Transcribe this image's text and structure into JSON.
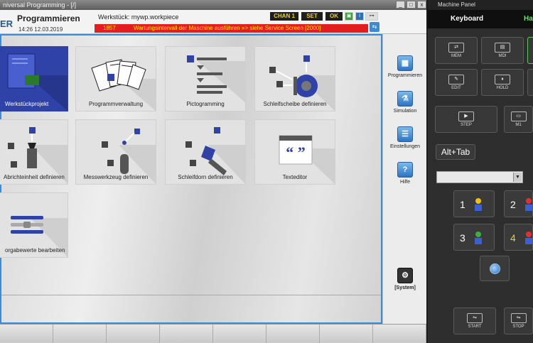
{
  "window": {
    "title": "niversal Programming - [/]",
    "controls": [
      "_",
      "□",
      "x"
    ]
  },
  "header": {
    "logo_text": "ER",
    "title": "Programmieren",
    "datetime": "14:26  12.03.2019",
    "workpiece": "Werkstück: mywp.workpiece",
    "chan": "CHAN 1",
    "set": "SET",
    "ok": "OK",
    "alarm_number": "1857",
    "alarm_text": "Wartungsintervall der Maschine ausführen => siehe Service Screen [2000]"
  },
  "tiles": [
    {
      "label": "Werkstückprojekt",
      "active": true
    },
    {
      "label": "Programmverwaltung",
      "active": false
    },
    {
      "label": "Pictogramming",
      "active": false
    },
    {
      "label": "Schleifscheibe definieren",
      "active": false
    },
    {
      "label": "Abrichteinheit definieren",
      "active": false
    },
    {
      "label": "Messwerkzeug definieren",
      "active": false
    },
    {
      "label": "Schleifdorn definieren",
      "active": false
    },
    {
      "label": "Texteditor",
      "active": false
    },
    {
      "label": "orgabewerte bearbeiten",
      "active": false
    }
  ],
  "right_bar": {
    "programmieren": "Programmieren",
    "simulation": "Simulation",
    "einstellungen": "Einstellungen",
    "hilfe": "Hilfe",
    "system": "[System]"
  },
  "panel": {
    "title": "Machine Panel",
    "keyboard": "Keyboard",
    "handwheel": "Han",
    "buttons": {
      "mem": "MEM",
      "mdi": "MDI",
      "edit": "EDIT",
      "hold": "HOLD",
      "step": "STEP",
      "m1": "M1",
      "start": "START",
      "stop": "STOP"
    },
    "alt_tab": "Alt+Tab",
    "channels": [
      "1",
      "2",
      "3",
      "4"
    ]
  },
  "colors": {
    "accent": "#2f42a8",
    "alarm_bg": "#e31e1e",
    "alarm_text": "#ffe200",
    "chan_text": "#f2d200"
  }
}
